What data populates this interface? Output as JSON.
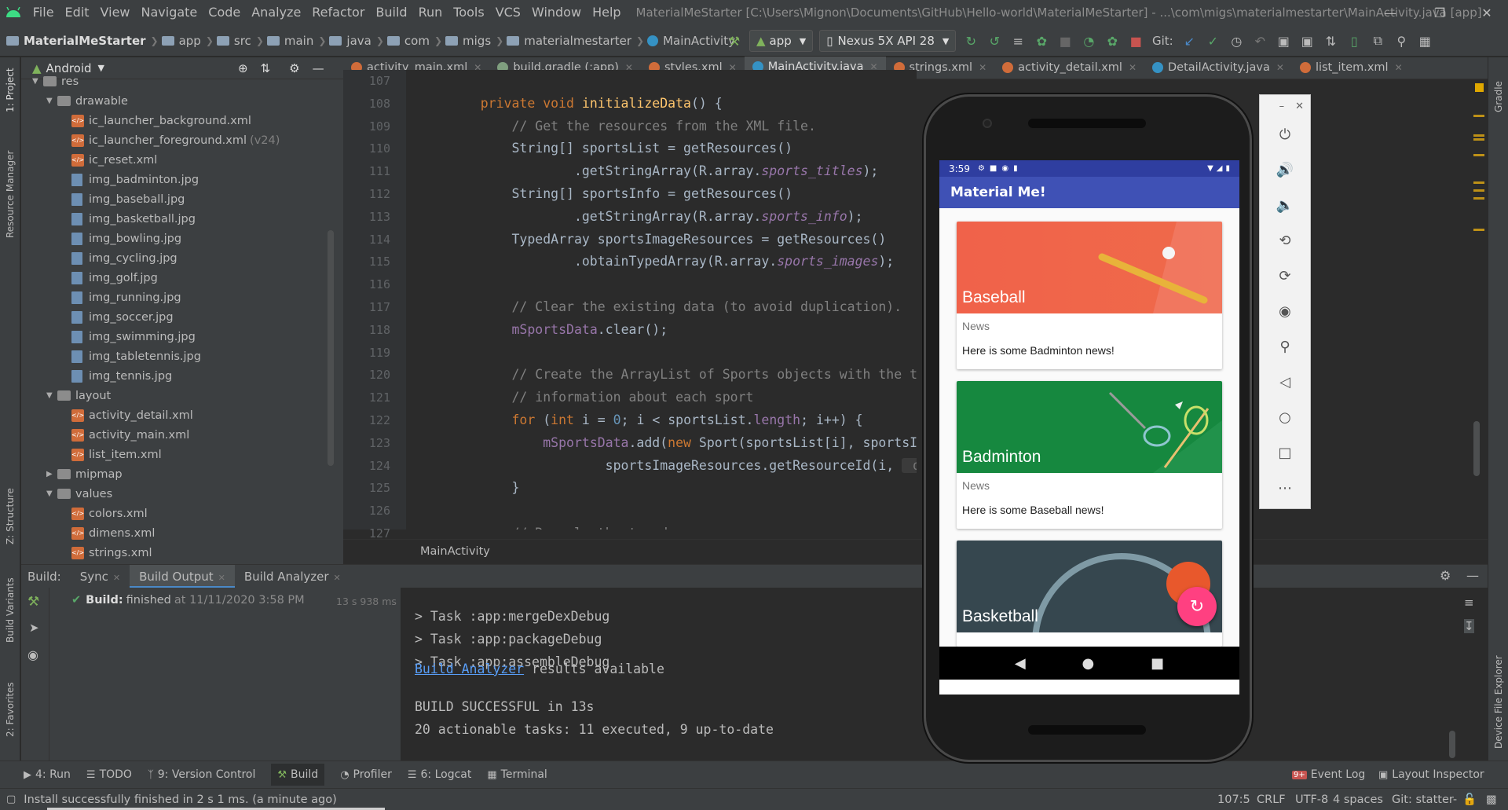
{
  "menubar": {
    "items": [
      "File",
      "Edit",
      "View",
      "Navigate",
      "Code",
      "Analyze",
      "Refactor",
      "Build",
      "Run",
      "Tools",
      "VCS",
      "Window",
      "Help"
    ],
    "window_title": "MaterialMeStarter [C:\\Users\\Mignon\\Documents\\GitHub\\Hello-world\\MaterialMeStarter] - ...\\com\\migs\\materialmestarter\\MainActivity.java [app]"
  },
  "navbar": {
    "crumbs": [
      "MaterialMeStarter",
      "app",
      "src",
      "main",
      "java",
      "com",
      "migs",
      "materialmestarter",
      "MainActivity"
    ],
    "run_config": "app",
    "device": "Nexus 5X API 28",
    "git_label": "Git:"
  },
  "project": {
    "view_label": "Android",
    "tree": [
      {
        "label": "res",
        "type": "folder",
        "level": 0,
        "open": true
      },
      {
        "label": "drawable",
        "type": "folder",
        "level": 1,
        "open": true
      },
      {
        "label": "ic_launcher_background.xml",
        "type": "xml",
        "level": 2
      },
      {
        "label": "ic_launcher_foreground.xml",
        "type": "xml",
        "level": 2,
        "note": "(v24)"
      },
      {
        "label": "ic_reset.xml",
        "type": "xml",
        "level": 2
      },
      {
        "label": "img_badminton.jpg",
        "type": "jpg",
        "level": 2
      },
      {
        "label": "img_baseball.jpg",
        "type": "jpg",
        "level": 2
      },
      {
        "label": "img_basketball.jpg",
        "type": "jpg",
        "level": 2
      },
      {
        "label": "img_bowling.jpg",
        "type": "jpg",
        "level": 2
      },
      {
        "label": "img_cycling.jpg",
        "type": "jpg",
        "level": 2
      },
      {
        "label": "img_golf.jpg",
        "type": "jpg",
        "level": 2
      },
      {
        "label": "img_running.jpg",
        "type": "jpg",
        "level": 2
      },
      {
        "label": "img_soccer.jpg",
        "type": "jpg",
        "level": 2
      },
      {
        "label": "img_swimming.jpg",
        "type": "jpg",
        "level": 2
      },
      {
        "label": "img_tabletennis.jpg",
        "type": "jpg",
        "level": 2
      },
      {
        "label": "img_tennis.jpg",
        "type": "jpg",
        "level": 2
      },
      {
        "label": "layout",
        "type": "folder",
        "level": 1,
        "open": true
      },
      {
        "label": "activity_detail.xml",
        "type": "xml",
        "level": 2
      },
      {
        "label": "activity_main.xml",
        "type": "xml",
        "level": 2
      },
      {
        "label": "list_item.xml",
        "type": "xml",
        "level": 2
      },
      {
        "label": "mipmap",
        "type": "folder",
        "level": 1,
        "open": false
      },
      {
        "label": "values",
        "type": "folder",
        "level": 1,
        "open": true
      },
      {
        "label": "colors.xml",
        "type": "xml",
        "level": 2
      },
      {
        "label": "dimens.xml",
        "type": "xml",
        "level": 2
      },
      {
        "label": "strings.xml",
        "type": "xml",
        "level": 2
      }
    ]
  },
  "left_stripe": {
    "project": "1: Project",
    "resource_manager": "Resource Manager",
    "structure": "Z: Structure",
    "build_variants": "Build Variants",
    "favorites": "2: Favorites"
  },
  "right_stripe": {
    "gradle": "Gradle",
    "device_file_explorer": "Device File Explorer"
  },
  "tabs": [
    {
      "label": "activity_main.xml",
      "color": "#d06c3a"
    },
    {
      "label": "build.gradle (:app)",
      "color": "#7f9f7f"
    },
    {
      "label": "styles.xml",
      "color": "#d06c3a"
    },
    {
      "label": "MainActivity.java",
      "color": "#3592c4",
      "active": true
    },
    {
      "label": "strings.xml",
      "color": "#d06c3a"
    },
    {
      "label": "activity_detail.xml",
      "color": "#d06c3a"
    },
    {
      "label": "DetailActivity.java",
      "color": "#3592c4"
    },
    {
      "label": "list_item.xml",
      "color": "#d06c3a"
    }
  ],
  "editor": {
    "line_numbers": [
      "107",
      "108",
      "109",
      "110",
      "111",
      "112",
      "113",
      "114",
      "115",
      "116",
      "117",
      "118",
      "119",
      "120",
      "121",
      "122",
      "123",
      "124",
      "125",
      "126",
      "127"
    ],
    "breadcrumb": "MainActivity",
    "lines": [
      [],
      [
        {
          "t": "    "
        },
        {
          "t": "private void ",
          "c": "kw"
        },
        {
          "t": "initializeData",
          "c": "fn"
        },
        {
          "t": "() {"
        }
      ],
      [
        {
          "t": "        "
        },
        {
          "t": "// Get the resources from the XML file.",
          "c": "cm"
        }
      ],
      [
        {
          "t": "        String[] sportsList = getResources()"
        }
      ],
      [
        {
          "t": "                .getStringArray(R.array."
        },
        {
          "t": "sports_titles",
          "c": "it"
        },
        {
          "t": ");"
        }
      ],
      [
        {
          "t": "        String[] sportsInfo = getResources()"
        }
      ],
      [
        {
          "t": "                .getStringArray(R.array."
        },
        {
          "t": "sports_info",
          "c": "it"
        },
        {
          "t": ");"
        }
      ],
      [
        {
          "t": "        TypedArray sportsImageResources = getResources()"
        }
      ],
      [
        {
          "t": "                .obtainTypedArray(R.array."
        },
        {
          "t": "sports_images",
          "c": "it"
        },
        {
          "t": ");"
        }
      ],
      [],
      [
        {
          "t": "        "
        },
        {
          "t": "// Clear the existing data (to avoid duplication).",
          "c": "cm"
        }
      ],
      [
        {
          "t": "        "
        },
        {
          "t": "mSportsData",
          "c": "fld"
        },
        {
          "t": ".clear();"
        }
      ],
      [],
      [
        {
          "t": "        "
        },
        {
          "t": "// Create the ArrayList of Sports objects with the titles",
          "c": "cm"
        }
      ],
      [
        {
          "t": "        "
        },
        {
          "t": "// information about each sport",
          "c": "cm"
        }
      ],
      [
        {
          "t": "        "
        },
        {
          "t": "for ",
          "c": "kw"
        },
        {
          "t": "("
        },
        {
          "t": "int ",
          "c": "kw"
        },
        {
          "t": "i = "
        },
        {
          "t": "0",
          "c": "num"
        },
        {
          "t": "; i < sportsList."
        },
        {
          "t": "length",
          "c": "fld"
        },
        {
          "t": "; i++) {"
        }
      ],
      [
        {
          "t": "            "
        },
        {
          "t": "mSportsData",
          "c": "fld"
        },
        {
          "t": ".add("
        },
        {
          "t": "new ",
          "c": "kw"
        },
        {
          "t": "Sport(sportsList[i], sportsInfo[i"
        }
      ],
      [
        {
          "t": "                    sportsImageResources.getResourceId(i, "
        },
        {
          "t": " defValu",
          "c": "hint"
        }
      ],
      [
        {
          "t": "        }"
        }
      ],
      [],
      [
        {
          "t": "        "
        },
        {
          "t": "// Recycle the typed array.",
          "c": "cm"
        }
      ]
    ]
  },
  "build": {
    "tabs": {
      "label": "Build:",
      "sync": "Sync",
      "output": "Build Output",
      "analyzer": "Build Analyzer"
    },
    "status_bold": "Build:",
    "status_text": "finished",
    "status_time": "at 11/11/2020 3:58 PM",
    "duration": "13 s 938 ms",
    "output_lines": [
      "> Task :app:mergeDexDebug",
      "> Task :app:packageDebug",
      "> Task :app:assembleDebug",
      "",
      "BUILD SUCCESSFUL in 13s",
      "20 actionable tasks: 11 executed, 9 up-to-date",
      ""
    ],
    "analyzer_link": "Build Analyzer",
    "analyzer_rest": " results available"
  },
  "toolwindows": {
    "run": "4: Run",
    "todo": "TODO",
    "vcs": "9: Version Control",
    "build": "Build",
    "profiler": "Profiler",
    "logcat": "6: Logcat",
    "terminal": "Terminal",
    "event_log": "Event Log",
    "event_count": "9+",
    "layout_inspector": "Layout Inspector"
  },
  "statusbar": {
    "message": "Install successfully finished in 2 s 1 ms. (a minute ago)",
    "position": "107:5",
    "line_sep": "CRLF",
    "encoding": "UTF-8",
    "indent": "4 spaces",
    "git": "Git: statter-"
  },
  "device": {
    "time": "3:59",
    "app_title": "Material Me!",
    "cards": [
      {
        "title": "Baseball",
        "subtitle": "News",
        "info": "Here is some Badminton news!",
        "color": "#f0624a"
      },
      {
        "title": "Badminton",
        "subtitle": "News",
        "info": "Here is some Baseball news!",
        "color": "#16883f"
      },
      {
        "title": "Basketball",
        "subtitle": "",
        "info": "",
        "color": "#36474f"
      }
    ],
    "fab_color": "#ff4081",
    "appbar_color": "#3f51b5"
  }
}
